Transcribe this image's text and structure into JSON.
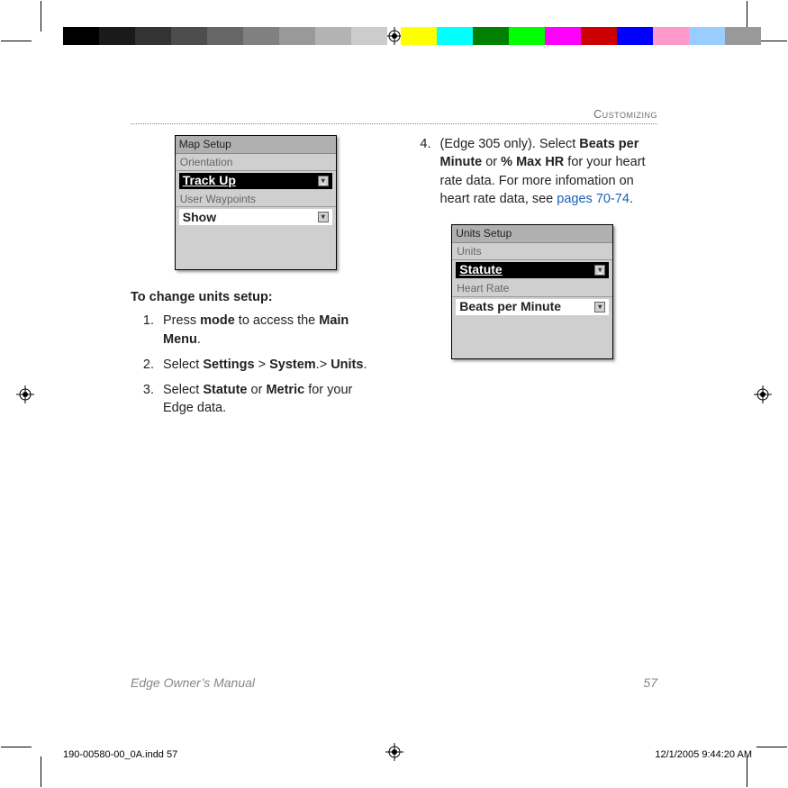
{
  "running_head": "Customizing",
  "left_col": {
    "device": {
      "title": "Map Setup",
      "label1": "Orientation",
      "field1": "Track Up",
      "label2": "User Waypoints",
      "field2": "Show"
    },
    "heading": "To change units setup:",
    "steps": [
      {
        "n": "1.",
        "pre": "Press ",
        "b1": "mode",
        "mid": " to access the ",
        "b2": "Main Menu",
        "post": "."
      },
      {
        "n": "2.",
        "pre": "Select ",
        "b1": "Settings",
        "mid": " > ",
        "b2": "System",
        "mid2": ".> ",
        "b3": "Units",
        "post": "."
      },
      {
        "n": "3.",
        "pre": "Select ",
        "b1": "Statute",
        "mid": " or ",
        "b2": "Metric",
        "post": " for your Edge data."
      }
    ]
  },
  "right_col": {
    "step4": {
      "n": "4.",
      "pre": "(Edge 305 only). Select ",
      "b1": "Beats per Minute",
      "mid": " or ",
      "b2": "% Max HR",
      "mid2": " for your heart rate data. For more infomation on heart rate data, see ",
      "link": "pages 70-74",
      "post": "."
    },
    "device": {
      "title": "Units Setup",
      "label1": "Units",
      "field1": "Statute",
      "label2": "Heart Rate",
      "field2": "Beats per Minute"
    }
  },
  "footer": {
    "title": "Edge Owner’s Manual",
    "page": "57"
  },
  "impo": {
    "file": "190-00580-00_0A.indd   57",
    "stamp": "12/1/2005   9:44:20 AM"
  }
}
